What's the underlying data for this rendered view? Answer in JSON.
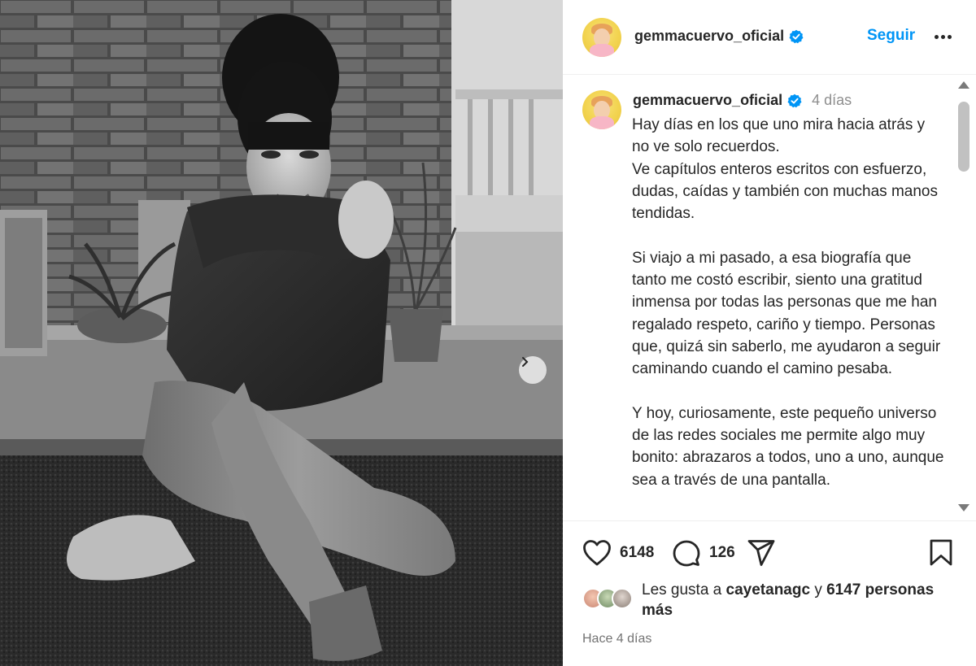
{
  "post": {
    "username": "gemmacuervo_oficial",
    "follow_label": "Seguir",
    "time_ago": "4 días",
    "caption": "Hay días en los que uno mira hacia atrás y no ve solo recuerdos.\nVe capítulos enteros escritos con esfuerzo, dudas, caídas y también con muchas manos tendidas.\n\nSi viajo a mi pasado, a esa biografía que tanto me costó escribir, siento una gratitud inmensa por todas las personas que me han regalado respeto, cariño y tiempo. Personas que, quizá sin saberlo, me ayudaron a seguir caminando cuando el camino pesaba.\n\nY hoy, curiosamente, este pequeño universo de las redes sociales me permite algo muy bonito: abrazaros a todos, uno a uno, aunque sea a través de una pantalla.",
    "likes_count": "6148",
    "comments_count": "126",
    "likes_prefix": "Les gusta a ",
    "liked_by_user": "cayetanagc",
    "likes_joiner": " y ",
    "likes_others": "6147 personas más",
    "posted_ago": "Hace 4 días"
  },
  "colors": {
    "accent_blue": "#0095f6",
    "verified_blue": "#0095f6",
    "text_primary": "#262626",
    "text_secondary": "#8e8e8e",
    "avatar_yellow": "#f2d34f"
  },
  "icons": {
    "like": "heart-icon",
    "comment": "comment-bubble-icon",
    "share": "paper-plane-icon",
    "save": "bookmark-icon",
    "more": "more-horizontal-icon",
    "verified": "verified-badge-icon",
    "carousel_next": "chevron-right-icon"
  }
}
